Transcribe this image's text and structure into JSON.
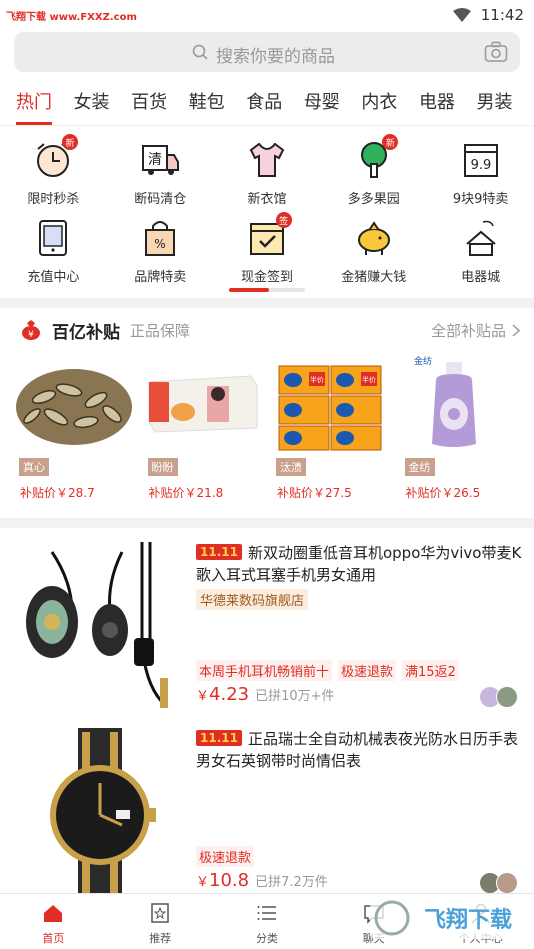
{
  "status_bar": {
    "watermark": "飞翔下载 www.FXXZ.com",
    "time": "11:42"
  },
  "search": {
    "placeholder": "搜索你要的商品",
    "icon": "search-icon",
    "camera_icon": "camera-icon"
  },
  "tabs": [
    "热门",
    "女装",
    "百货",
    "鞋包",
    "食品",
    "母婴",
    "内衣",
    "电器",
    "男装"
  ],
  "active_tab": "热门",
  "grid_row1": [
    {
      "label": "限时秒杀",
      "icon": "alarm-clock-icon",
      "badge": "新"
    },
    {
      "label": "断码清仓",
      "icon": "delivery-truck-icon",
      "icon_text": "清"
    },
    {
      "label": "新衣馆",
      "icon": "shirt-icon"
    },
    {
      "label": "多多果园",
      "icon": "tree-icon",
      "badge": "新"
    },
    {
      "label": "9块9特卖",
      "icon": "calendar-9-icon",
      "icon_text": "9.9"
    }
  ],
  "grid_row2": [
    {
      "label": "充值中心",
      "icon": "tablet-icon"
    },
    {
      "label": "品牌特卖",
      "icon": "shopping-bag-icon"
    },
    {
      "label": "现金签到",
      "icon": "calendar-check-icon",
      "badge": "签"
    },
    {
      "label": "金猪赚大钱",
      "icon": "piggy-bank-icon"
    },
    {
      "label": "电器城",
      "icon": "appliance-icon"
    }
  ],
  "colors": {
    "accent": "#e02e24",
    "tag_brown": "#c9a08c"
  },
  "subsidy": {
    "title": "百亿补贴",
    "subtitle": "正品保障",
    "more": "全部补贴品",
    "items": [
      {
        "tag": "真心",
        "price": "补贴价￥28.7",
        "image": "sunflower-seeds"
      },
      {
        "tag": "盼盼",
        "price": "补贴价￥21.8",
        "image": "snack-box"
      },
      {
        "tag": "汰渍",
        "price": "补贴价￥27.5",
        "image": "detergent-packs",
        "pack_text": "半价"
      },
      {
        "tag": "金纺",
        "price": "补贴价￥26.5",
        "image": "softener-bottle",
        "brand_text": "金纺"
      }
    ]
  },
  "products": [
    {
      "tag": "11.11",
      "title": "新双动圈重低音耳机oppo华为vivo带麦K歌入耳式耳塞手机男女通用",
      "shop": "华德莱数码旗舰店",
      "promos": [
        "本周手机耳机畅销前十",
        "极速退款",
        "满15返2"
      ],
      "currency": "￥",
      "price": "4.23",
      "sold": "已拼10万+件",
      "image": "earphones"
    },
    {
      "tag": "11.11",
      "title": "正品瑞士全自动机械表夜光防水日历手表男女石英钢带时尚情侣表",
      "promos": [
        "极速退款"
      ],
      "currency": "￥",
      "price": "10.8",
      "sold": "已拼7.2万件",
      "image": "wristwatch"
    }
  ],
  "bottom_nav": [
    {
      "label": "首页",
      "icon": "home-icon"
    },
    {
      "label": "推荐",
      "icon": "recommend-icon"
    },
    {
      "label": "分类",
      "icon": "category-list-icon"
    },
    {
      "label": "聊天",
      "icon": "chat-icon"
    },
    {
      "label": "个人中心",
      "icon": "user-icon"
    }
  ],
  "corner_watermark": "飞翔下载"
}
